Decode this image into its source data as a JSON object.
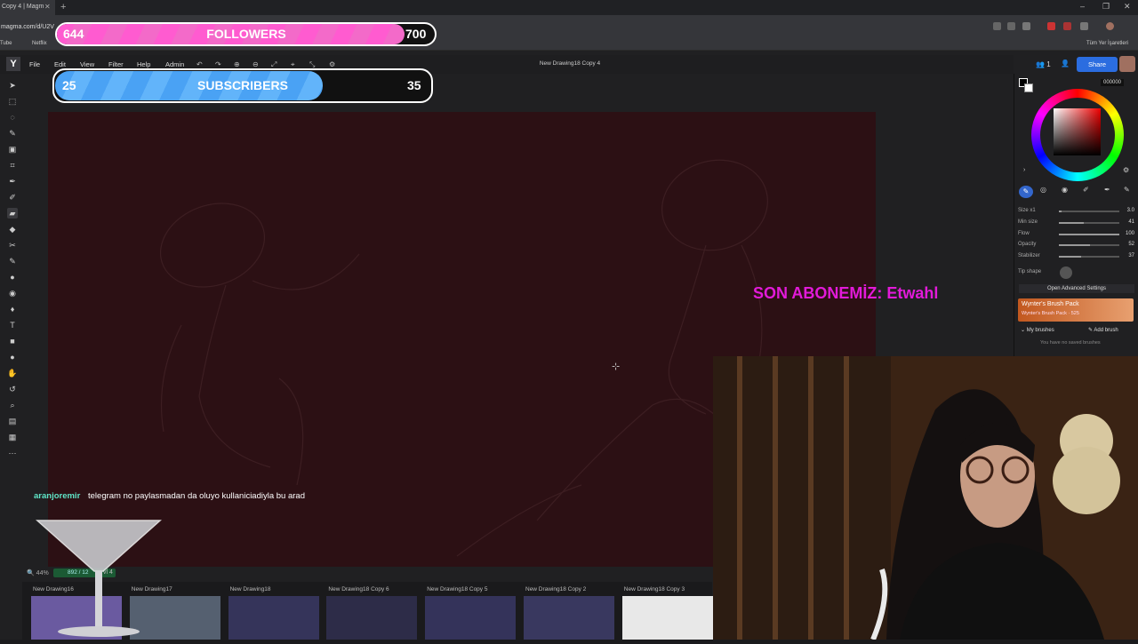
{
  "browser": {
    "tab_title": "Copy 4 | Magm",
    "tab_close": "✕",
    "new_tab": "+",
    "url": "magma.com/d/U2V",
    "bookmarks": [
      "Tube",
      "Netflix"
    ],
    "bookmarks_right": "Tüm Yer İşaretleri",
    "window_controls": [
      "–",
      "❐",
      "✕"
    ]
  },
  "app": {
    "logo": "Y",
    "menu": [
      "File",
      "Edit",
      "View",
      "Filter",
      "Help",
      "Admin"
    ],
    "toolbar_icons": [
      "↶",
      "↷",
      "⊕",
      "⊖",
      "⤢",
      "⌖",
      "⤡",
      "⚙"
    ],
    "doc_title": "New Drawing18 Copy 4",
    "users_count": "1",
    "share_label": "Share",
    "zoom": "44%",
    "stats": "892 / 12",
    "stats_suffix": "vl 4",
    "tools": [
      "➤",
      "⬚",
      "◌",
      "✎",
      "▣",
      "⌗",
      "✒",
      "✐",
      "▰",
      "◆",
      "✂",
      "✎",
      "●",
      "◉",
      "♦",
      "T",
      "■",
      "●",
      "✋",
      "↺",
      "⌕",
      "▤",
      "▦",
      "⋯"
    ],
    "cursor": "⊹"
  },
  "panel": {
    "hex": "000000",
    "rows": [
      {
        "label": "Size x1",
        "value": "3.0",
        "fill": 0.05
      },
      {
        "label": "Min size",
        "value": "41",
        "fill": 0.41
      },
      {
        "label": "Flow",
        "value": "100",
        "fill": 1.0
      },
      {
        "label": "Opacity",
        "value": "52",
        "fill": 0.52
      },
      {
        "label": "Stabilizer",
        "value": "37",
        "fill": 0.37
      }
    ],
    "tip_shape": "Tip shape",
    "advanced": "Open Advanced Settings",
    "brushpack_title": "Wynter's Brush Pack",
    "brushpack_sub": "Wynter's Brush Pack · 525",
    "my_brushes": "My brushes",
    "add_brush": "Add brush",
    "no_brushes": "You have no saved brushes"
  },
  "thumbnails": [
    {
      "label": "New Drawing16",
      "color": "#6a5aa0"
    },
    {
      "label": "New Drawing17",
      "color": "#556070"
    },
    {
      "label": "New Drawing18",
      "color": "#35345a"
    },
    {
      "label": "New Drawing18 Copy 6",
      "color": "#2d2c48"
    },
    {
      "label": "New Drawing18 Copy 5",
      "color": "#34335a"
    },
    {
      "label": "New Drawing18 Copy 2",
      "color": "#39385f"
    },
    {
      "label": "New Drawing18 Copy 3",
      "color": "#e8e8e8"
    }
  ],
  "overlay": {
    "followers_current": "644",
    "followers_title": "FOLLOWERS",
    "followers_goal": "700",
    "followers_progress": 0.92,
    "subs_current": "25",
    "subs_title": "SUBSCRIBERS",
    "subs_goal": "35",
    "subs_progress": 0.71,
    "last_sub": "SON ABONEMİZ: Etwahl",
    "chat_user": "aranjoremir",
    "chat_message": "telegram no paylasmadan da oluyo kullaniciadiyla bu arad"
  },
  "colors": {
    "canvas": "#2c1014",
    "followers": "#ff5bd0",
    "subscribers": "#4aa2f4",
    "last_sub": "#e21ad9",
    "chat_user": "#5fe6c8",
    "share": "#2b6de0"
  }
}
